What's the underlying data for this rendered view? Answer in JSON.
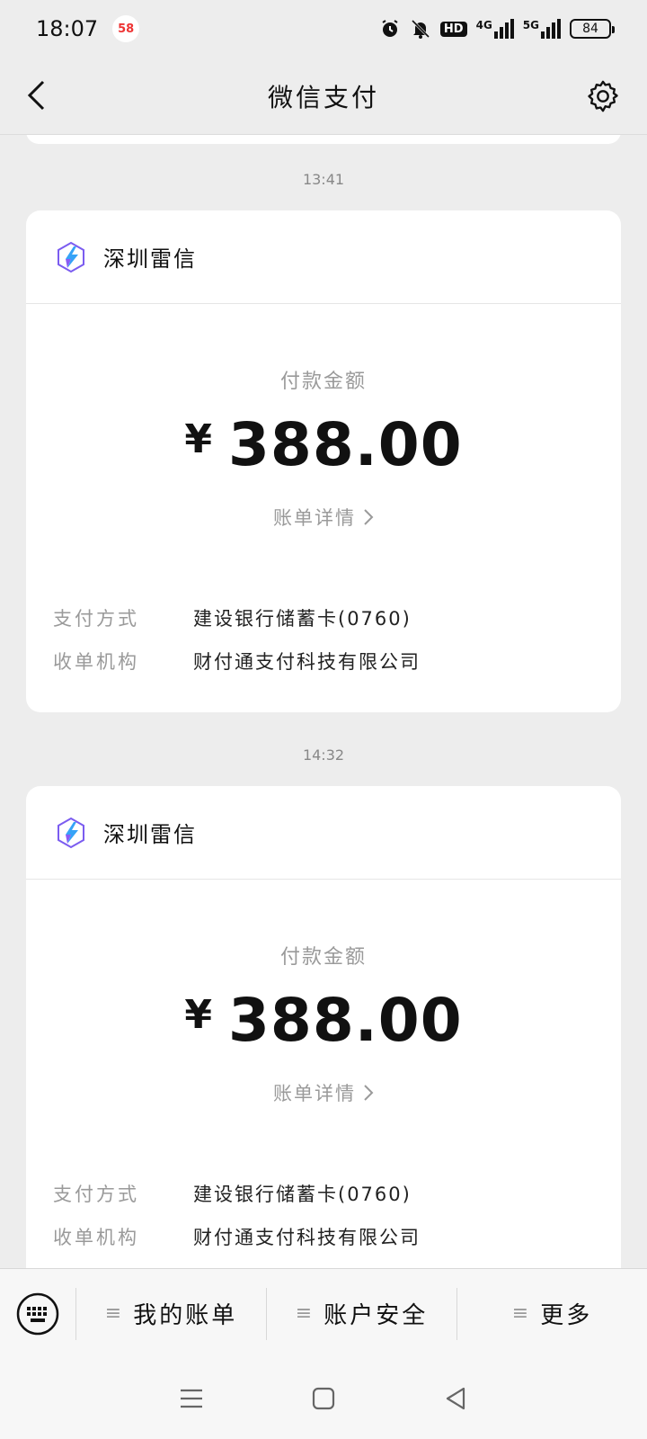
{
  "status_bar": {
    "time": "18:07",
    "app_badge": "58",
    "hd": "HD",
    "net1": "4G",
    "net2": "5G",
    "battery": "84"
  },
  "header": {
    "title": "微信支付"
  },
  "messages": [
    {
      "time": "13:41",
      "merchant": "深圳雷信",
      "amount_label": "付款金额",
      "currency": "¥",
      "amount": "388.00",
      "details_link": "账单详情",
      "rows": [
        {
          "key": "支付方式",
          "value": "建设银行储蓄卡(0760)"
        },
        {
          "key": "收单机构",
          "value": "财付通支付科技有限公司"
        }
      ]
    },
    {
      "time": "14:32",
      "merchant": "深圳雷信",
      "amount_label": "付款金额",
      "currency": "¥",
      "amount": "388.00",
      "details_link": "账单详情",
      "rows": [
        {
          "key": "支付方式",
          "value": "建设银行储蓄卡(0760)"
        },
        {
          "key": "收单机构",
          "value": "财付通支付科技有限公司"
        }
      ]
    }
  ],
  "bottom_menu": {
    "items": [
      "我的账单",
      "账户安全",
      "更多"
    ]
  }
}
